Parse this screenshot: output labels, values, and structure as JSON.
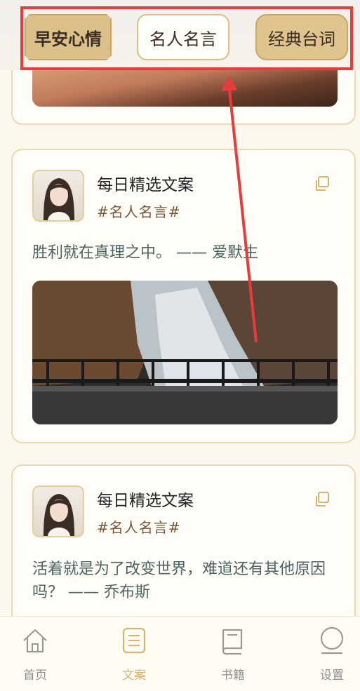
{
  "tabs": [
    {
      "label": "早安心情",
      "state": "active"
    },
    {
      "label": "名人名言",
      "state": "selected"
    },
    {
      "label": "经典台词",
      "state": "normal"
    }
  ],
  "posts": [
    {
      "title": "每日精选文案",
      "tag": "#名人名言#",
      "quote": "胜利就在真理之中。 —— 爱默生"
    },
    {
      "title": "每日精选文案",
      "tag": "#名人名言#",
      "quote": "活着就是为了改变世界，难道还有其他原因吗？ —— 乔布斯"
    }
  ],
  "bottom_nav": [
    {
      "label": "首页",
      "icon": "home-icon"
    },
    {
      "label": "文案",
      "icon": "document-icon",
      "active": true
    },
    {
      "label": "书籍",
      "icon": "book-icon"
    },
    {
      "label": "设置",
      "icon": "user-icon"
    }
  ],
  "colors": {
    "accent": "#d9b46f",
    "highlight": "#e83b3b",
    "quote_text": "#4c6461",
    "tag_text": "#7a5637"
  }
}
